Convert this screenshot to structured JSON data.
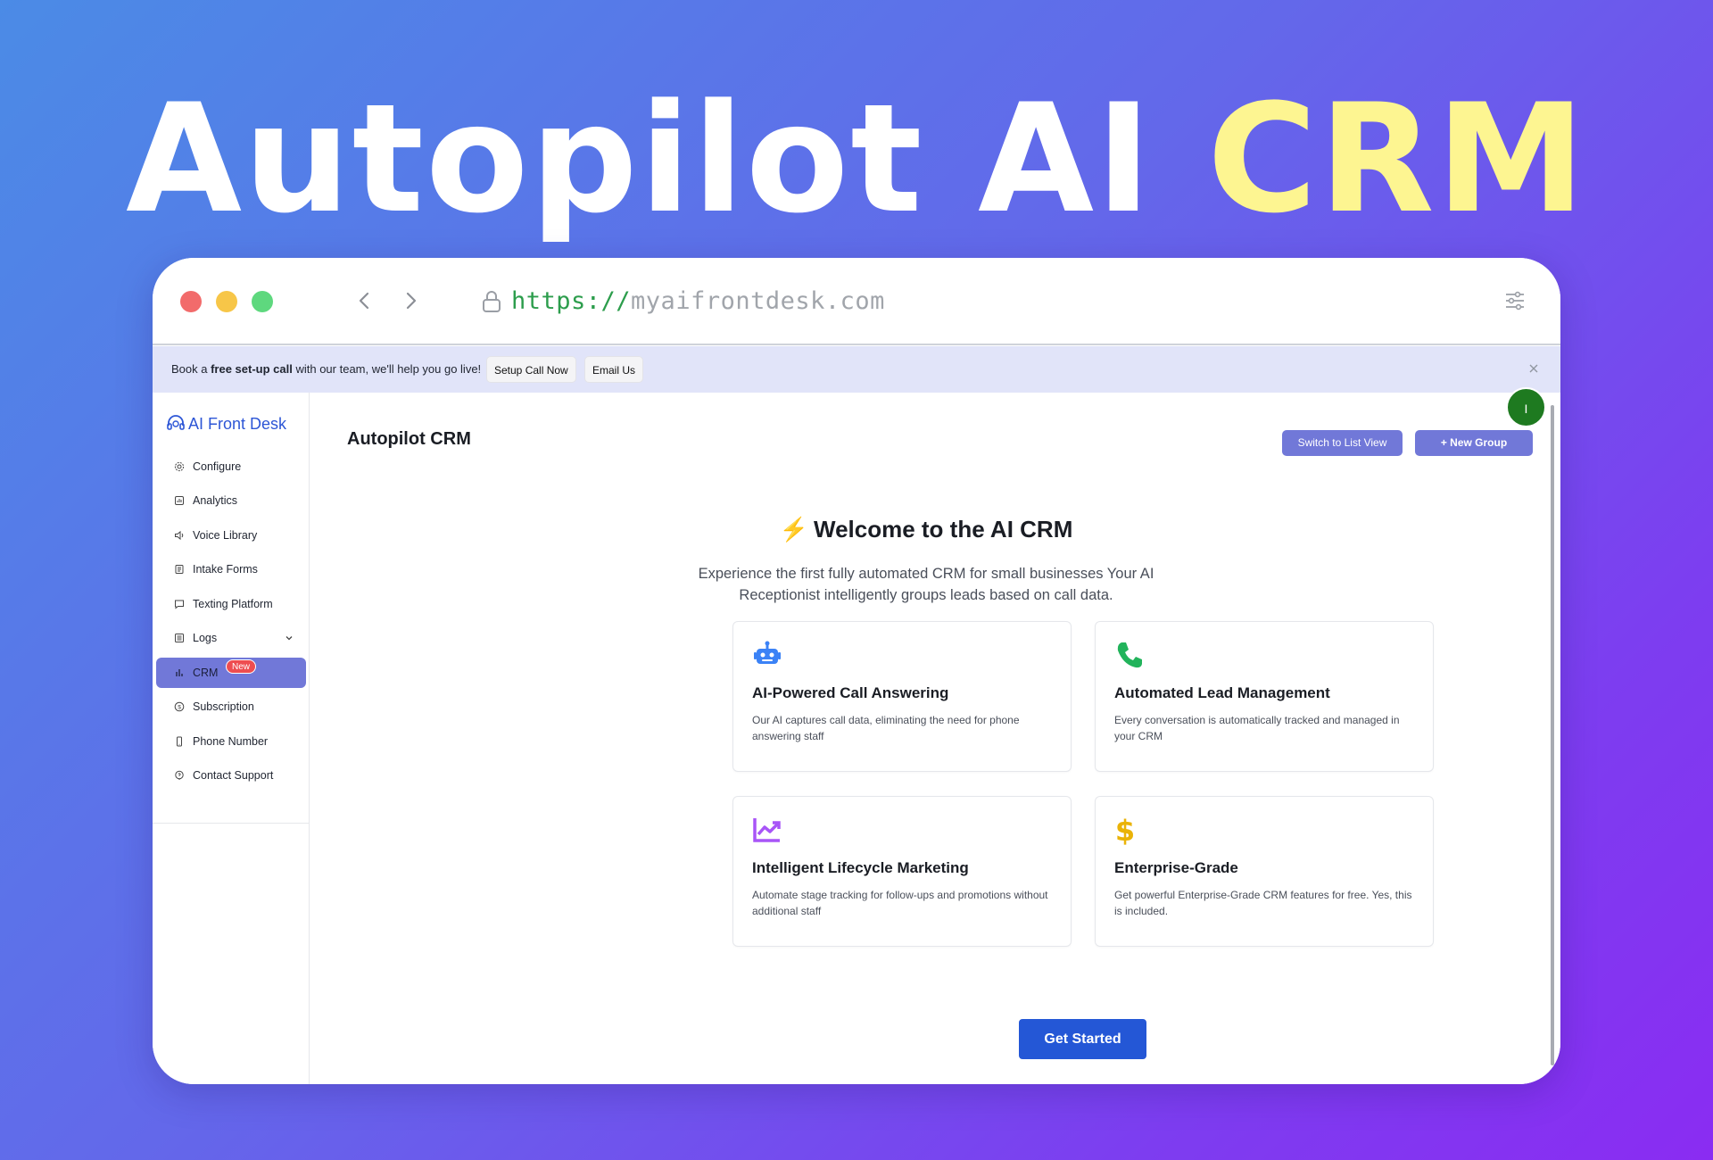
{
  "hero": {
    "title_part1": "Autopilot AI ",
    "title_part2": "CRM"
  },
  "browser": {
    "url_scheme": "https://",
    "url_host": "myaifrontdesk.com"
  },
  "banner": {
    "text_before": "Book a ",
    "text_bold": "free set-up call",
    "text_after": " with our team, we'll help you go live!",
    "setup_button": "Setup Call Now",
    "email_button": "Email Us"
  },
  "sidebar": {
    "logo_text": "AI Front Desk",
    "items": [
      {
        "label": "Configure",
        "icon": "gear-icon"
      },
      {
        "label": "Analytics",
        "icon": "chart-icon"
      },
      {
        "label": "Voice Library",
        "icon": "speaker-icon"
      },
      {
        "label": "Intake Forms",
        "icon": "form-icon"
      },
      {
        "label": "Texting Platform",
        "icon": "message-icon"
      },
      {
        "label": "Logs",
        "icon": "logs-icon"
      },
      {
        "label": "CRM",
        "icon": "bar-chart-icon",
        "badge": "New",
        "active": true
      },
      {
        "label": "Subscription",
        "icon": "dollar-circle-icon"
      },
      {
        "label": "Phone Number",
        "icon": "phone-device-icon"
      },
      {
        "label": "Contact Support",
        "icon": "support-icon"
      }
    ]
  },
  "main": {
    "title": "Autopilot CRM",
    "switch_view_button": "Switch to List View",
    "new_group_button": "+ New Group",
    "avatar_initial": "I",
    "welcome_icon": "⚡",
    "welcome_title": "Welcome to the AI CRM",
    "subtitle": "Experience the first fully automated CRM for small businesses Your AI Receptionist intelligently groups leads based on call data.",
    "cards": [
      {
        "title": "AI-Powered Call Answering",
        "desc": "Our AI captures call data, eliminating the need for phone answering staff",
        "icon": "robot-icon",
        "color": "#3b82f6"
      },
      {
        "title": "Automated Lead Management",
        "desc": "Every conversation is automatically tracked and managed in your CRM",
        "icon": "phone-icon",
        "color": "#22b35b"
      },
      {
        "title": "Intelligent Lifecycle Marketing",
        "desc": "Automate stage tracking for follow-ups and promotions without additional staff",
        "icon": "trend-up-icon",
        "color": "#a855f7"
      },
      {
        "title": "Enterprise-Grade",
        "desc": "Get powerful Enterprise-Grade CRM features for free. Yes, this is included.",
        "icon": "dollar-icon",
        "color": "#eab308"
      }
    ],
    "get_started_button": "Get Started"
  },
  "colors": {
    "accent": "#7178d8",
    "primary": "#2457d6",
    "hero_accent": "#fdf591"
  }
}
